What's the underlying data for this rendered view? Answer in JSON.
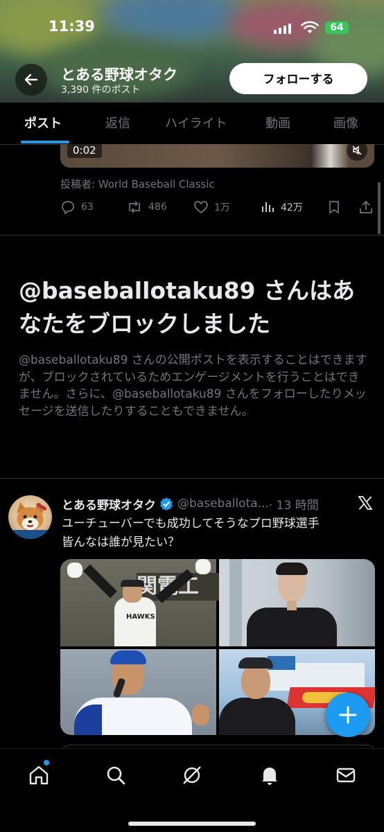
{
  "status_bar": {
    "time": "11:39",
    "battery": "64"
  },
  "profile_header": {
    "name": "とある野球オタク",
    "post_count": "3,390 件のポスト",
    "follow_label": "フォローする"
  },
  "tabs": [
    {
      "label": "ポスト",
      "active": true
    },
    {
      "label": "返信",
      "active": false
    },
    {
      "label": "ハイライト",
      "active": false
    },
    {
      "label": "動画",
      "active": false
    },
    {
      "label": "画像",
      "active": false
    }
  ],
  "prev_post": {
    "video_duration": "0:02",
    "posted_by": "投稿者: World Baseball Classic",
    "replies": "63",
    "reposts": "486",
    "likes": "1万",
    "views": "42万"
  },
  "block_notice": {
    "title": "@baseballotaku89 さんはあなたをブロックしました",
    "description": "@baseballotaku89 さんの公開ポストを表示することはできますが、ブロックされているためエンゲージメントを行うことはできません。さらに、@baseballotaku89 さんをフォローしたりメッセージを送信したりすることもできません。"
  },
  "tweet": {
    "name": "とある野球オタク",
    "handle": "@baseballota...",
    "time": "· 13 時間",
    "text_line1": "ユーチューバーでも成功してそうなプロ野球選手",
    "text_line2": "皆んなは誰が見たい？",
    "images": [
      "baseball-player-photo",
      "man-in-black-suit-photo",
      "player-with-microphone-photo",
      "man-at-harbor-photo"
    ]
  },
  "fab_icon": "plus-icon",
  "bottom_nav": [
    "home-icon",
    "search-icon",
    "grok-icon",
    "notifications-icon",
    "messages-icon"
  ],
  "colors": {
    "accent": "#1d9bf0",
    "background": "#000000",
    "secondary_text": "#71767b",
    "battery": "#35c759"
  }
}
